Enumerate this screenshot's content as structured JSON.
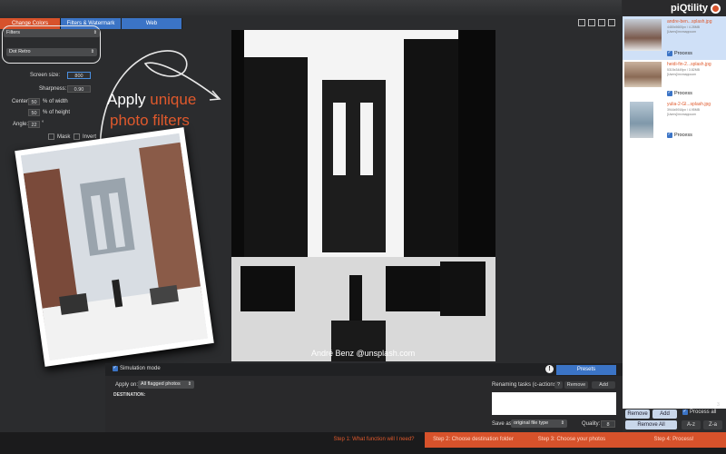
{
  "app": {
    "brand": "piQtility"
  },
  "tabs": [
    {
      "label": "Change Colors"
    },
    {
      "label": "Filters & Watermark"
    },
    {
      "label": "Web"
    }
  ],
  "filters_panel": {
    "category": "Filters",
    "filter": "Dot Retro",
    "screen_size_label": "Screen size:",
    "screen_size_value": "800",
    "sharpness_label": "Sharpness:",
    "sharpness_value": "0.90",
    "center_label": "Center:",
    "center_x_value": "50",
    "center_x_unit": "% of width",
    "center_y_value": "50",
    "center_y_unit": "% of height",
    "angle_label": "Angle:",
    "angle_value": "22",
    "angle_unit": "°",
    "mask_label": "Mask",
    "invert_label": "Invert"
  },
  "promo": {
    "line1_prefix": "Apply ",
    "line1_highlight": "unique",
    "line2": "photo filters"
  },
  "preview": {
    "credit": "André Benz @unsplash.com"
  },
  "sidebar": {
    "items": [
      {
        "name": "andre-ben...splash.jpg",
        "dims": "4480x5600px / 4.28MB",
        "path": "[Users]/mxmappcom",
        "process": "Process"
      },
      {
        "name": "heidi-fin-2...splash.jpg",
        "dims": "5315x3449px / 3.82MB",
        "path": "[Users]/mxmappcom",
        "process": "Process"
      },
      {
        "name": "yulia-2-Gl...splash.jpg",
        "dims": "3944x5916px / 4.95MB",
        "path": "[Users]/mxmappcom",
        "process": "Process"
      }
    ],
    "count": "3",
    "remove_label": "Remove",
    "add_label": "Add",
    "process_all_label": "Process all",
    "remove_all_label": "Remove All",
    "sort_az": "A-z",
    "sort_za": "Z-a"
  },
  "bottom": {
    "simulation_label": "Simulation mode",
    "presets_label": "Presets",
    "apply_on_label": "Apply on:",
    "apply_on_value": "All flagged photos",
    "destination_label": "DESTINATION:",
    "renaming_label": "Renaming tasks (c-actions):",
    "help_label": "?",
    "remove_label": "Remove",
    "add_label": "Add",
    "save_as_label": "Save as:",
    "save_as_value": "original file type",
    "quality_label": "Quality:",
    "quality_value": "8"
  },
  "steps": {
    "step1": "Step 1: What function will I need?",
    "step2": "Step 2: Choose destination folder",
    "step3": "Step 3: Choose your photos",
    "step4": "Step 4: Process!"
  },
  "colors": {
    "accent": "#d7522b",
    "blue": "#3b74c6"
  }
}
